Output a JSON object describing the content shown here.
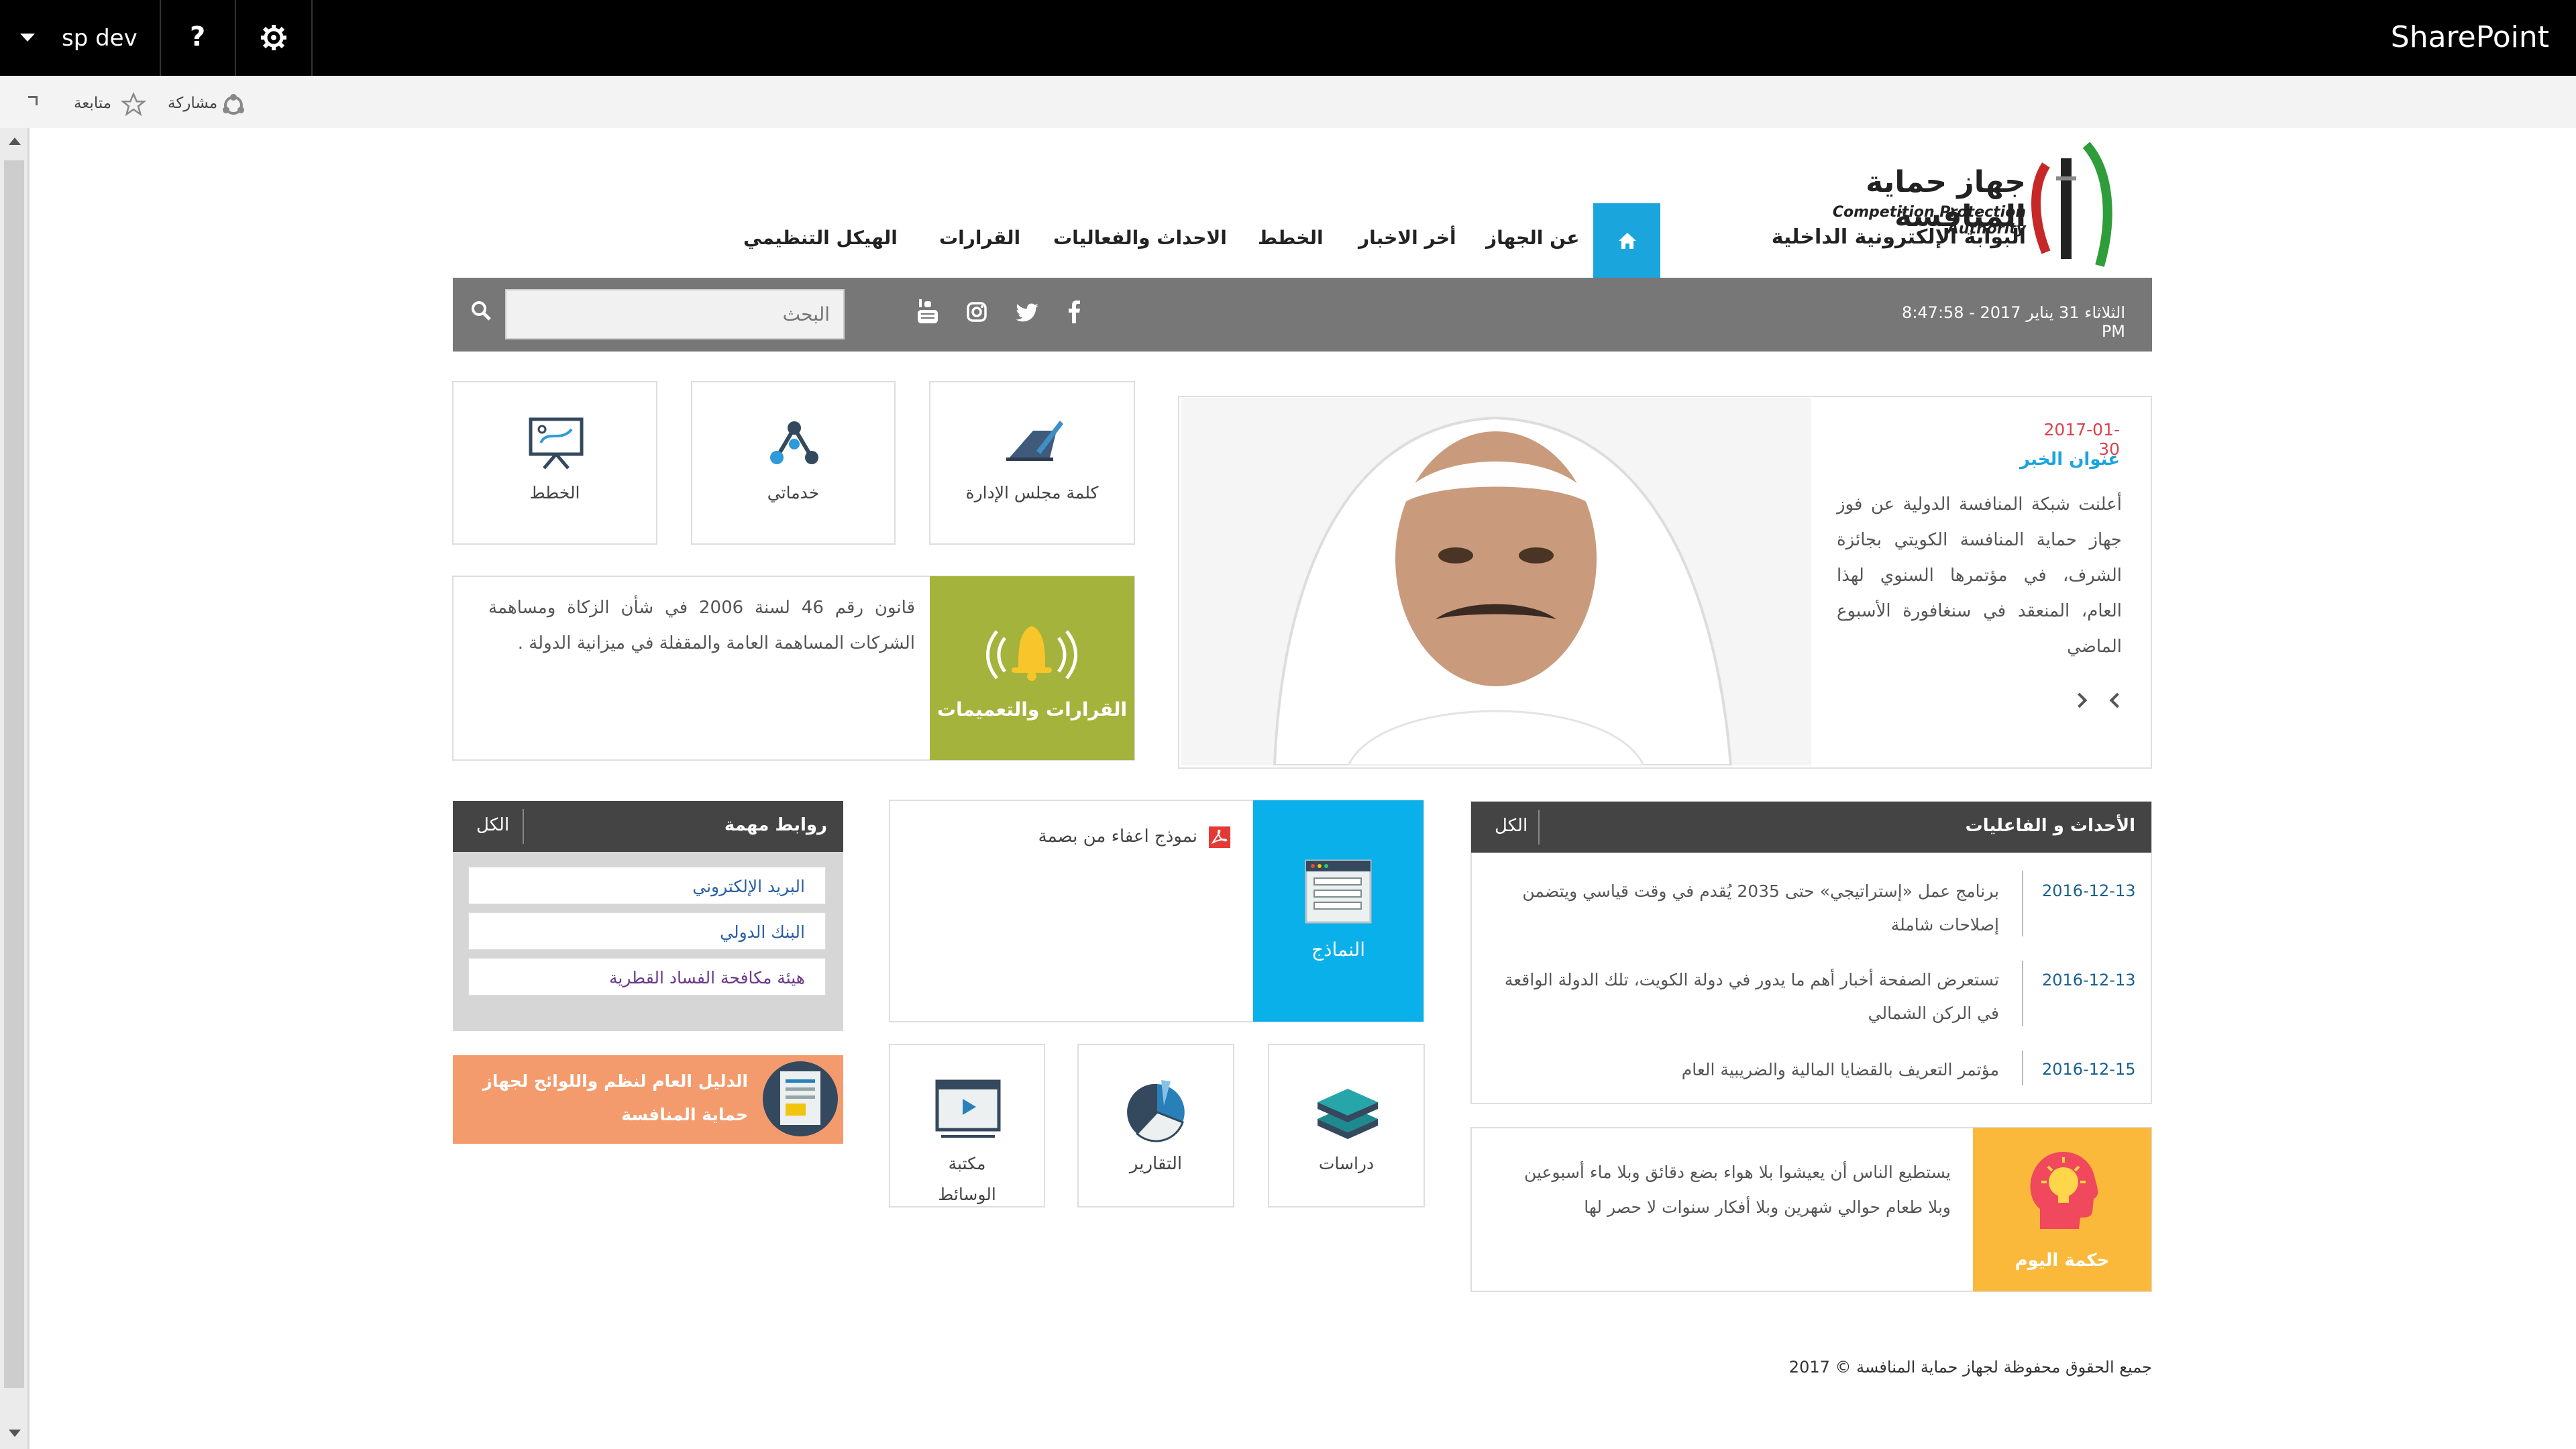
{
  "suite_bar": {
    "site_name": "sp dev",
    "help_label": "?",
    "brand": "SharePoint"
  },
  "ribbon": {
    "share_label": "مشاركة",
    "follow_label": "متابعة"
  },
  "logo": {
    "name_ar": "جهاز حماية المنافسة",
    "name_en": "Competition Protection Authority",
    "portal": "البوابة الإلكترونية الداخلية"
  },
  "nav": {
    "items": [
      "عن الجهاز",
      "أخر الاخبار",
      "الخطط",
      "الاحداث والفعاليات",
      "القرارات",
      "الهيكل التنظيمي"
    ]
  },
  "strip": {
    "datetime": "الثلاثاء 31 يناير 2017 - 8:47:58 PM",
    "search_placeholder": "البحث"
  },
  "news": {
    "date": "2017-01-30",
    "title": "عنوان الخبر",
    "body": "أعلنت شبكة المنافسة الدولية عن فوز جهاز حماية المنافسة الكويتي بجائزة الشرف، في مؤتمرها السنوي لهذا العام، المنعقد في سنغافورة الأسبوع الماضي"
  },
  "quick_tiles": {
    "board_word": "كلمة مجلس الإدارة",
    "my_services": "خدماتي",
    "plans": "الخطط"
  },
  "decisions": {
    "label": "القرارات والتعميمات",
    "text": "قانون رقم 46 لسنة 2006 في شأن الزكاة ومساهمة الشركات المساهمة العامة والمقفلة في ميزانية الدولة ."
  },
  "events": {
    "title": "الأحداث و الفاعليات",
    "all_label": "الكل",
    "items": [
      {
        "date": "2016-12-13",
        "text": "برنامج عمل «إستراتيجي» حتى 2035 يُقدم في وقت قياسي ويتضمن إصلاحات شاملة"
      },
      {
        "date": "2016-12-13",
        "text": "تستعرض الصفحة أخبار أهم ما يدور في دولة الكويت، تلك الدولة الواقعة في الركن الشمالي"
      },
      {
        "date": "2016-12-15",
        "text": "مؤتمر التعريف بالقضايا المالية والضريبية العام"
      }
    ]
  },
  "wisdom": {
    "label": "حكمة اليوم",
    "text": "يستطيع الناس أن يعيشوا بلا هواء بضع دقائق وبلا ماء أسبوعين وبلا طعام حوالي شهرين وبلا أفكار سنوات لا حصر لها"
  },
  "forms": {
    "label": "النماذج",
    "item": "نموذج اعفاء من بصمة"
  },
  "bottom_tiles": {
    "studies": "دراسات",
    "reports": "التقارير",
    "media_line1": "مكتبة",
    "media_line2": "الوسائط"
  },
  "links": {
    "title": "روابط مهمة",
    "all_label": "الكل",
    "items": [
      "البريد الإلكتروني",
      "البنك الدولي",
      "هيئة مكافحة الفساد القطرية"
    ]
  },
  "guide": {
    "line1": "الدليل العام لنظم واللوائح لجهاز",
    "line2": "حماية المنافسة"
  },
  "footer": {
    "text": "جميع الحقوق محفوظة لجهاز حماية المنافسة © 2017"
  },
  "colors": {
    "accent": "#1aa5dd",
    "decisions_green": "#a4b33c",
    "forms_blue": "#0ab0ea",
    "wisdom_yellow": "#fbb93c",
    "guide_orange": "#f39b6d",
    "news_date_red": "#d9434e"
  }
}
